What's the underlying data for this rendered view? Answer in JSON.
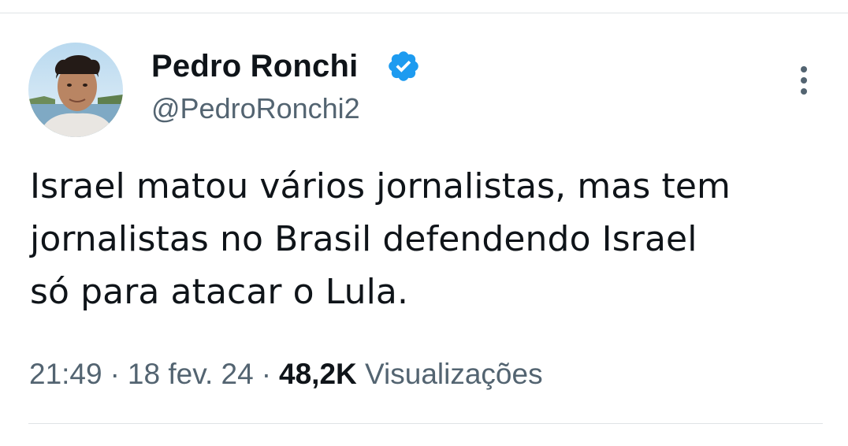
{
  "tweet": {
    "author": {
      "display_name": "Pedro Ronchi",
      "handle": "@PedroRonchi2",
      "verified": true
    },
    "text_lines": [
      "Israel matou vários jornalistas, mas tem",
      "jornalistas no Brasil defendendo Israel",
      "só para atacar o Lula."
    ],
    "time": "21:49",
    "date": "18 fev. 24",
    "separator": "·",
    "views_count": "48,2K",
    "views_label": "Visualizações"
  },
  "colors": {
    "text_primary": "#0f1419",
    "text_secondary": "#536471",
    "verified_blue": "#1d9bf0",
    "divider": "#dfe3e6"
  },
  "icons": {
    "verified": "verified-badge-icon",
    "more": "more-vertical-icon"
  }
}
